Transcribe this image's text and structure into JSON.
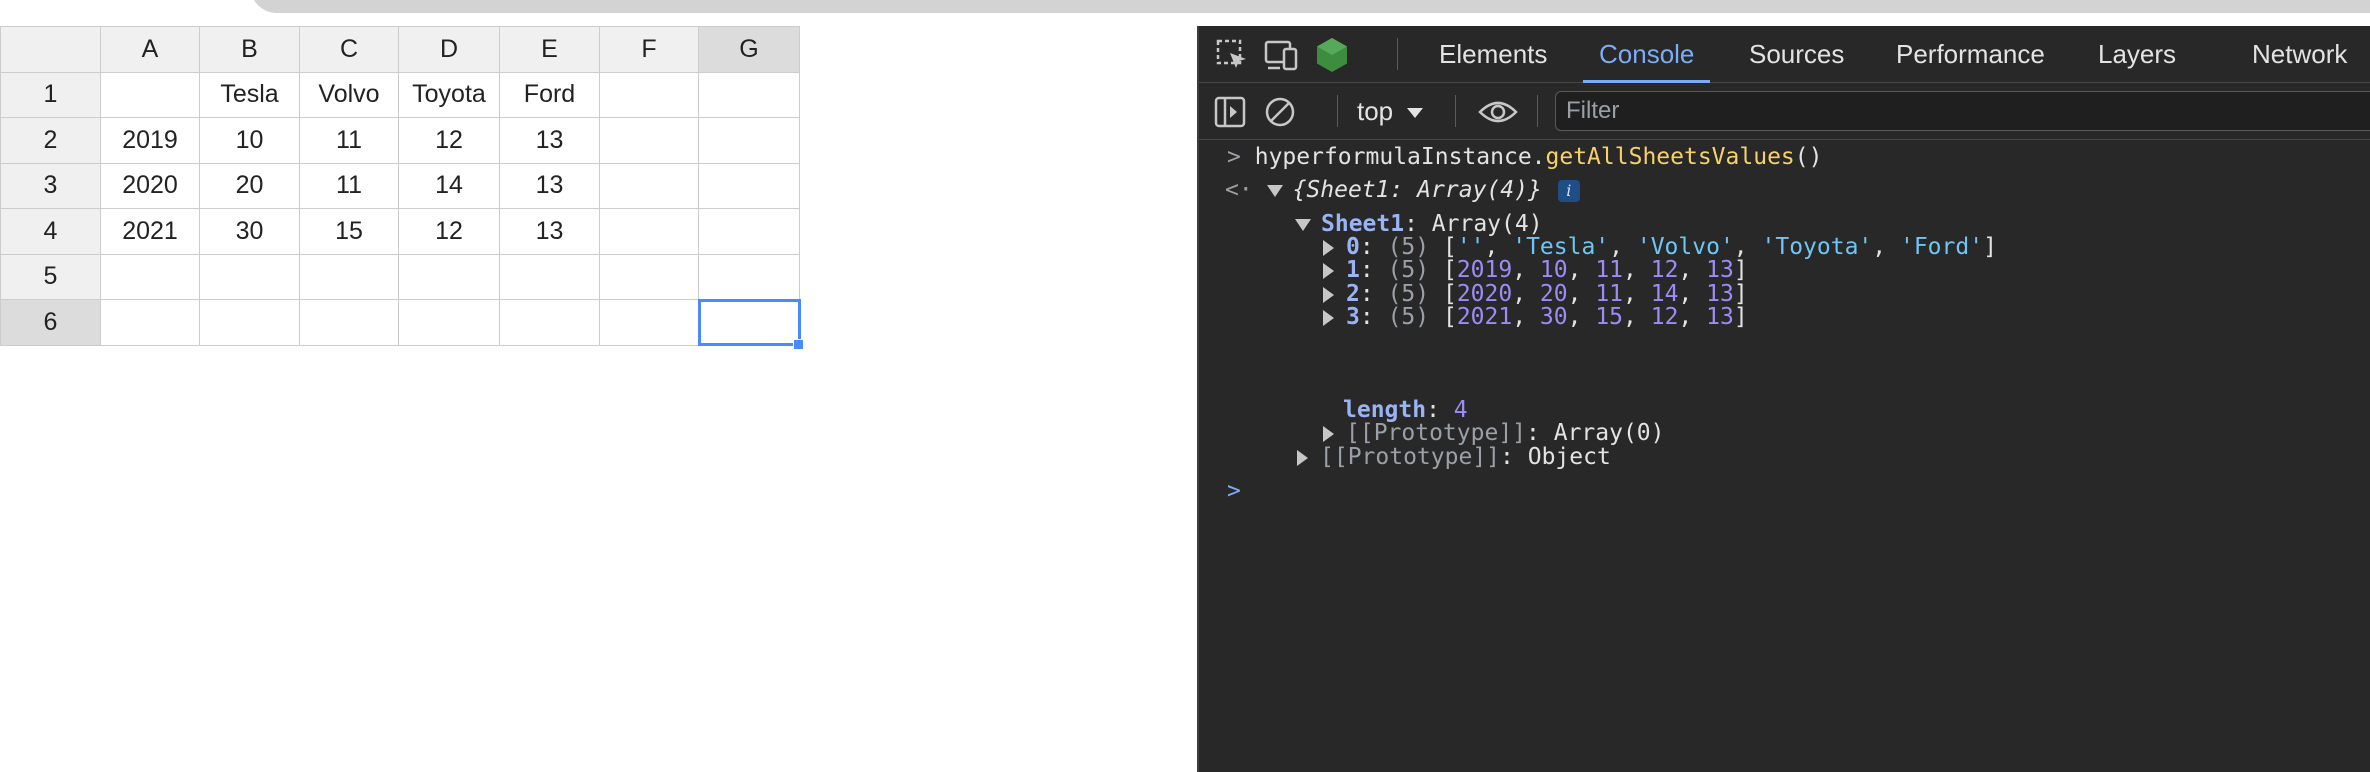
{
  "spreadsheet": {
    "column_headers": [
      "A",
      "B",
      "C",
      "D",
      "E",
      "F",
      "G"
    ],
    "row_headers": [
      "1",
      "2",
      "3",
      "4",
      "5",
      "6"
    ],
    "rows": [
      [
        "",
        "Tesla",
        "Volvo",
        "Toyota",
        "Ford",
        "",
        ""
      ],
      [
        "2019",
        "10",
        "11",
        "12",
        "13",
        "",
        ""
      ],
      [
        "2020",
        "20",
        "11",
        "14",
        "13",
        "",
        ""
      ],
      [
        "2021",
        "30",
        "15",
        "12",
        "13",
        "",
        ""
      ],
      [
        "",
        "",
        "",
        "",
        "",
        "",
        ""
      ],
      [
        "",
        "",
        "",
        "",
        "",
        "",
        ""
      ]
    ],
    "active_cell": "G6"
  },
  "devtools": {
    "tabs": [
      {
        "label": "Elements"
      },
      {
        "label": "Console"
      },
      {
        "label": "Sources"
      },
      {
        "label": "Performance"
      },
      {
        "label": "Layers"
      },
      {
        "label": "Network"
      }
    ],
    "active_tab": "Console",
    "context_select": "top",
    "filter_placeholder": "Filter",
    "console": {
      "prompt": ">",
      "command_object": "hyperformulaInstance.",
      "command_method": "getAllSheetsValues",
      "command_suffix": "()",
      "result_arrow": "<·",
      "result_summary": "{Sheet1: Array(4)}",
      "info_badge": "i",
      "sheet_key": "Sheet1",
      "sheet_value": ": Array(4)",
      "entries": [
        {
          "index": "0",
          "count": "(5)",
          "values": [
            "''",
            "'Tesla'",
            "'Volvo'",
            "'Toyota'",
            "'Ford'"
          ]
        },
        {
          "index": "1",
          "count": "(5)",
          "values": [
            "2019",
            "10",
            "11",
            "12",
            "13"
          ]
        },
        {
          "index": "2",
          "count": "(5)",
          "values": [
            "2020",
            "20",
            "11",
            "14",
            "13"
          ]
        },
        {
          "index": "3",
          "count": "(5)",
          "values": [
            "2021",
            "30",
            "15",
            "12",
            "13"
          ]
        }
      ],
      "length_key": "length",
      "length_value": "4",
      "array_proto_key": "[[Prototype]]",
      "array_proto_value": "Array(0)",
      "object_proto_key": "[[Prototype]]",
      "object_proto_value": "Object",
      "input_prompt": ">"
    }
  },
  "colors": {
    "accent": "#7cacf8",
    "selection": "#4b89ff",
    "devtools_bg": "#282828"
  }
}
